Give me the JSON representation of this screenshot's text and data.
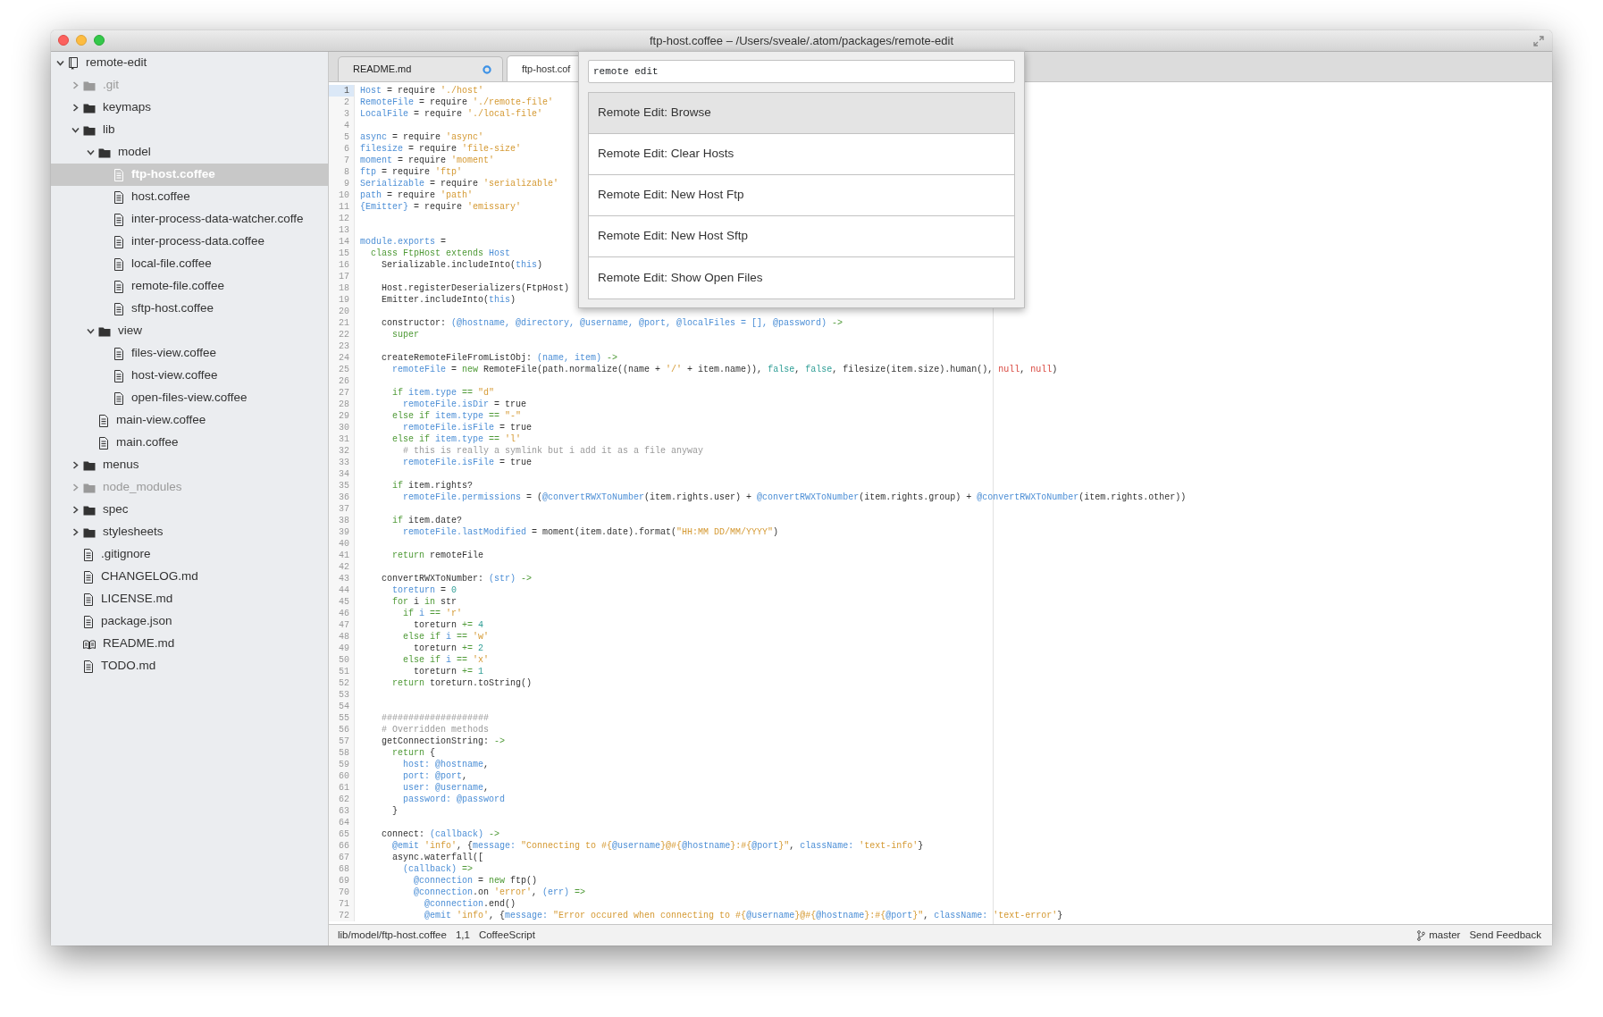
{
  "window": {
    "title": "ftp-host.coffee – /Users/sveale/.atom/packages/remote-edit"
  },
  "tree": [
    {
      "label": "remote-edit",
      "kind": "repo",
      "expanded": true,
      "selected": false,
      "ignored": false,
      "children": [
        {
          "label": ".git",
          "kind": "folder",
          "expanded": false,
          "selected": false,
          "ignored": true
        },
        {
          "label": "keymaps",
          "kind": "folder",
          "expanded": false,
          "selected": false,
          "ignored": false
        },
        {
          "label": "lib",
          "kind": "folder",
          "expanded": true,
          "selected": false,
          "ignored": false,
          "children": [
            {
              "label": "model",
              "kind": "folder",
              "expanded": true,
              "selected": false,
              "ignored": false,
              "children": [
                {
                  "label": "ftp-host.coffee",
                  "kind": "file",
                  "selected": true,
                  "ignored": false
                },
                {
                  "label": "host.coffee",
                  "kind": "file",
                  "selected": false,
                  "ignored": false
                },
                {
                  "label": "inter-process-data-watcher.coffe",
                  "kind": "file",
                  "selected": false,
                  "ignored": false
                },
                {
                  "label": "inter-process-data.coffee",
                  "kind": "file",
                  "selected": false,
                  "ignored": false
                },
                {
                  "label": "local-file.coffee",
                  "kind": "file",
                  "selected": false,
                  "ignored": false
                },
                {
                  "label": "remote-file.coffee",
                  "kind": "file",
                  "selected": false,
                  "ignored": false
                },
                {
                  "label": "sftp-host.coffee",
                  "kind": "file",
                  "selected": false,
                  "ignored": false
                }
              ]
            },
            {
              "label": "view",
              "kind": "folder",
              "expanded": true,
              "selected": false,
              "ignored": false,
              "children": [
                {
                  "label": "files-view.coffee",
                  "kind": "file",
                  "selected": false,
                  "ignored": false
                },
                {
                  "label": "host-view.coffee",
                  "kind": "file",
                  "selected": false,
                  "ignored": false
                },
                {
                  "label": "open-files-view.coffee",
                  "kind": "file",
                  "selected": false,
                  "ignored": false
                }
              ]
            },
            {
              "label": "main-view.coffee",
              "kind": "file",
              "selected": false,
              "ignored": false
            },
            {
              "label": "main.coffee",
              "kind": "file",
              "selected": false,
              "ignored": false
            }
          ]
        },
        {
          "label": "menus",
          "kind": "folder",
          "expanded": false,
          "selected": false,
          "ignored": false
        },
        {
          "label": "node_modules",
          "kind": "folder",
          "expanded": false,
          "selected": false,
          "ignored": true
        },
        {
          "label": "spec",
          "kind": "folder",
          "expanded": false,
          "selected": false,
          "ignored": false
        },
        {
          "label": "stylesheets",
          "kind": "folder",
          "expanded": false,
          "selected": false,
          "ignored": false
        },
        {
          "label": ".gitignore",
          "kind": "file",
          "selected": false,
          "ignored": false
        },
        {
          "label": "CHANGELOG.md",
          "kind": "file",
          "selected": false,
          "ignored": false
        },
        {
          "label": "LICENSE.md",
          "kind": "file",
          "selected": false,
          "ignored": false
        },
        {
          "label": "package.json",
          "kind": "file",
          "selected": false,
          "ignored": false
        },
        {
          "label": "README.md",
          "kind": "readme",
          "selected": false,
          "ignored": false
        },
        {
          "label": "TODO.md",
          "kind": "file",
          "selected": false,
          "ignored": false
        }
      ]
    }
  ],
  "tabs": [
    {
      "label": "README.md",
      "selected": false,
      "modified": true
    },
    {
      "label": "ftp-host.cof",
      "selected": true,
      "modified": false
    }
  ],
  "palette": {
    "query": "remote edit",
    "items": [
      {
        "label": "Remote Edit: Browse",
        "selected": true
      },
      {
        "label": "Remote Edit: Clear Hosts",
        "selected": false
      },
      {
        "label": "Remote Edit: New Host Ftp",
        "selected": false
      },
      {
        "label": "Remote Edit: New Host Sftp",
        "selected": false
      },
      {
        "label": "Remote Edit: Show Open Files",
        "selected": false
      }
    ]
  },
  "editor": {
    "lines": [
      {
        "number": "1",
        "current": true,
        "tokens": [
          {
            "kind": "var",
            "text": "Host"
          },
          {
            "kind": "plain",
            "text": " = require "
          },
          {
            "kind": "string",
            "text": "'./host'"
          }
        ]
      },
      {
        "number": "2",
        "current": false,
        "tokens": [
          {
            "kind": "var",
            "text": "RemoteFile"
          },
          {
            "kind": "plain",
            "text": " = require "
          },
          {
            "kind": "string",
            "text": "'./remote-file'"
          }
        ]
      },
      {
        "number": "3",
        "current": false,
        "tokens": [
          {
            "kind": "var",
            "text": "LocalFile"
          },
          {
            "kind": "plain",
            "text": " = require "
          },
          {
            "kind": "string",
            "text": "'./local-file'"
          }
        ]
      },
      {
        "number": "4",
        "current": false
      },
      {
        "number": "5",
        "current": false,
        "tokens": [
          {
            "kind": "var",
            "text": "async"
          },
          {
            "kind": "plain",
            "text": " = require "
          },
          {
            "kind": "string",
            "text": "'async'"
          }
        ]
      },
      {
        "number": "6",
        "current": false,
        "tokens": [
          {
            "kind": "var",
            "text": "filesize"
          },
          {
            "kind": "plain",
            "text": " = require "
          },
          {
            "kind": "string",
            "text": "'file-size'"
          }
        ]
      },
      {
        "number": "7",
        "current": false,
        "tokens": [
          {
            "kind": "var",
            "text": "moment"
          },
          {
            "kind": "plain",
            "text": " = require "
          },
          {
            "kind": "string",
            "text": "'moment'"
          }
        ]
      },
      {
        "number": "8",
        "current": false,
        "tokens": [
          {
            "kind": "var",
            "text": "ftp"
          },
          {
            "kind": "plain",
            "text": " = require "
          },
          {
            "kind": "string",
            "text": "'ftp'"
          }
        ]
      },
      {
        "number": "9",
        "current": false,
        "tokens": [
          {
            "kind": "var",
            "text": "Serializable"
          },
          {
            "kind": "plain",
            "text": " = require "
          },
          {
            "kind": "string",
            "text": "'serializable'"
          }
        ]
      },
      {
        "number": "10",
        "current": false,
        "tokens": [
          {
            "kind": "var",
            "text": "path"
          },
          {
            "kind": "plain",
            "text": " = require "
          },
          {
            "kind": "string",
            "text": "'path'"
          }
        ]
      },
      {
        "number": "11",
        "current": false,
        "tokens": [
          {
            "kind": "var",
            "text": "{Emitter}"
          },
          {
            "kind": "plain",
            "text": " = require "
          },
          {
            "kind": "string",
            "text": "'emissary'"
          }
        ]
      },
      {
        "number": "12",
        "current": false
      },
      {
        "number": "13",
        "current": false
      },
      {
        "number": "14",
        "current": false,
        "tokens": [
          {
            "kind": "var",
            "text": "module.exports"
          },
          {
            "kind": "plain",
            "text": " ="
          }
        ]
      },
      {
        "number": "15",
        "current": false,
        "tokens": [
          {
            "kind": "keyword",
            "text": "  class FtpHost extends"
          },
          {
            "kind": "var",
            "text": " Host"
          }
        ]
      },
      {
        "number": "16",
        "current": false,
        "tokens": [
          {
            "kind": "plain",
            "text": "    Serializable.includeInto("
          },
          {
            "kind": "var",
            "text": "this"
          },
          {
            "kind": "plain",
            "text": ")"
          }
        ]
      },
      {
        "number": "17",
        "current": false
      },
      {
        "number": "18",
        "current": false,
        "tokens": [
          {
            "kind": "plain",
            "text": "    Host.registerDeserializers(FtpHost)"
          }
        ]
      },
      {
        "number": "19",
        "current": false,
        "tokens": [
          {
            "kind": "plain",
            "text": "    Emitter.includeInto("
          },
          {
            "kind": "var",
            "text": "this"
          },
          {
            "kind": "plain",
            "text": ")"
          }
        ]
      },
      {
        "number": "20",
        "current": false
      },
      {
        "number": "21",
        "current": false,
        "tokens": [
          {
            "kind": "plain",
            "text": "    constructor: "
          },
          {
            "kind": "var",
            "text": "(@hostname, @directory, @username, @port, @localFiles = [], @password)"
          },
          {
            "kind": "keyword",
            "text": " ->"
          }
        ]
      },
      {
        "number": "22",
        "current": false,
        "tokens": [
          {
            "kind": "keyword",
            "text": "      super"
          }
        ]
      },
      {
        "number": "23",
        "current": false
      },
      {
        "number": "24",
        "current": false,
        "tokens": [
          {
            "kind": "plain",
            "text": "    createRemoteFileFromListObj: "
          },
          {
            "kind": "var",
            "text": "(name, item)"
          },
          {
            "kind": "keyword",
            "text": " ->"
          }
        ]
      },
      {
        "number": "25",
        "current": false,
        "tokens": [
          {
            "kind": "var",
            "text": "      remoteFile"
          },
          {
            "kind": "plain",
            "text": " = "
          },
          {
            "kind": "keyword",
            "text": "new"
          },
          {
            "kind": "plain",
            "text": " RemoteFile(path.normalize((name + "
          },
          {
            "kind": "string",
            "text": "'/'"
          },
          {
            "kind": "plain",
            "text": " + item.name)), "
          },
          {
            "kind": "number",
            "text": "false"
          },
          {
            "kind": "plain",
            "text": ", "
          },
          {
            "kind": "number",
            "text": "false"
          },
          {
            "kind": "plain",
            "text": ", filesize(item.size).human(), "
          },
          {
            "kind": "null",
            "text": "null"
          },
          {
            "kind": "plain",
            "text": ", "
          },
          {
            "kind": "null",
            "text": "null"
          },
          {
            "kind": "plain",
            "text": ")"
          }
        ]
      },
      {
        "number": "26",
        "current": false
      },
      {
        "number": "27",
        "current": false,
        "tokens": [
          {
            "kind": "keyword",
            "text": "      if "
          },
          {
            "kind": "var",
            "text": "item.type"
          },
          {
            "kind": "keyword",
            "text": " == "
          },
          {
            "kind": "string",
            "text": "\"d\""
          }
        ]
      },
      {
        "number": "28",
        "current": false,
        "tokens": [
          {
            "kind": "var",
            "text": "        remoteFile.isDir"
          },
          {
            "kind": "plain",
            "text": " = true"
          }
        ]
      },
      {
        "number": "29",
        "current": false,
        "tokens": [
          {
            "kind": "keyword",
            "text": "      else if "
          },
          {
            "kind": "var",
            "text": "item.type"
          },
          {
            "kind": "keyword",
            "text": " == "
          },
          {
            "kind": "string",
            "text": "\"-\""
          }
        ]
      },
      {
        "number": "30",
        "current": false,
        "tokens": [
          {
            "kind": "var",
            "text": "        remoteFile.isFile"
          },
          {
            "kind": "plain",
            "text": " = true"
          }
        ]
      },
      {
        "number": "31",
        "current": false,
        "tokens": [
          {
            "kind": "keyword",
            "text": "      else if "
          },
          {
            "kind": "var",
            "text": "item.type"
          },
          {
            "kind": "keyword",
            "text": " == "
          },
          {
            "kind": "string",
            "text": "'l'"
          }
        ]
      },
      {
        "number": "32",
        "current": false,
        "tokens": [
          {
            "kind": "comment",
            "text": "        # this is really a symlink but i add it as a file anyway"
          }
        ]
      },
      {
        "number": "33",
        "current": false,
        "tokens": [
          {
            "kind": "var",
            "text": "        remoteFile.isFile"
          },
          {
            "kind": "plain",
            "text": " = true"
          }
        ]
      },
      {
        "number": "34",
        "current": false
      },
      {
        "number": "35",
        "current": false,
        "tokens": [
          {
            "kind": "keyword",
            "text": "      if "
          },
          {
            "kind": "plain",
            "text": "item.rights?"
          }
        ]
      },
      {
        "number": "36",
        "current": false,
        "tokens": [
          {
            "kind": "var",
            "text": "        remoteFile.permissions"
          },
          {
            "kind": "plain",
            "text": " = ("
          },
          {
            "kind": "var",
            "text": "@convertRWXToNumber"
          },
          {
            "kind": "plain",
            "text": "(item.rights.user) + "
          },
          {
            "kind": "var",
            "text": "@convertRWXToNumber"
          },
          {
            "kind": "plain",
            "text": "(item.rights.group) + "
          },
          {
            "kind": "var",
            "text": "@convertRWXToNumber"
          },
          {
            "kind": "plain",
            "text": "(item.rights.other))"
          }
        ]
      },
      {
        "number": "37",
        "current": false
      },
      {
        "number": "38",
        "current": false,
        "tokens": [
          {
            "kind": "keyword",
            "text": "      if "
          },
          {
            "kind": "plain",
            "text": "item.date?"
          }
        ]
      },
      {
        "number": "39",
        "current": false,
        "tokens": [
          {
            "kind": "var",
            "text": "        remoteFile.lastModified"
          },
          {
            "kind": "plain",
            "text": " = moment(item.date).format("
          },
          {
            "kind": "string",
            "text": "\"HH:MM DD/MM/YYYY\""
          },
          {
            "kind": "plain",
            "text": ")"
          }
        ]
      },
      {
        "number": "40",
        "current": false
      },
      {
        "number": "41",
        "current": false,
        "tokens": [
          {
            "kind": "keyword",
            "text": "      return"
          },
          {
            "kind": "plain",
            "text": " remoteFile"
          }
        ]
      },
      {
        "number": "42",
        "current": false
      },
      {
        "number": "43",
        "current": false,
        "tokens": [
          {
            "kind": "plain",
            "text": "    convertRWXToNumber: "
          },
          {
            "kind": "var",
            "text": "(str)"
          },
          {
            "kind": "keyword",
            "text": " ->"
          }
        ]
      },
      {
        "number": "44",
        "current": false,
        "tokens": [
          {
            "kind": "var",
            "text": "      toreturn"
          },
          {
            "kind": "plain",
            "text": " = "
          },
          {
            "kind": "number",
            "text": "0"
          }
        ]
      },
      {
        "number": "45",
        "current": false,
        "tokens": [
          {
            "kind": "keyword",
            "text": "      for "
          },
          {
            "kind": "plain",
            "text": "i"
          },
          {
            "kind": "keyword",
            "text": " in "
          },
          {
            "kind": "plain",
            "text": "str"
          }
        ]
      },
      {
        "number": "46",
        "current": false,
        "tokens": [
          {
            "kind": "keyword",
            "text": "        if "
          },
          {
            "kind": "var",
            "text": "i"
          },
          {
            "kind": "keyword",
            "text": " == "
          },
          {
            "kind": "string",
            "text": "'r'"
          }
        ]
      },
      {
        "number": "47",
        "current": false,
        "tokens": [
          {
            "kind": "plain",
            "text": "          toreturn "
          },
          {
            "kind": "keyword",
            "text": "+= "
          },
          {
            "kind": "number",
            "text": "4"
          }
        ]
      },
      {
        "number": "48",
        "current": false,
        "tokens": [
          {
            "kind": "keyword",
            "text": "        else if "
          },
          {
            "kind": "var",
            "text": "i"
          },
          {
            "kind": "keyword",
            "text": " == "
          },
          {
            "kind": "string",
            "text": "'w'"
          }
        ]
      },
      {
        "number": "49",
        "current": false,
        "tokens": [
          {
            "kind": "plain",
            "text": "          toreturn "
          },
          {
            "kind": "keyword",
            "text": "+= "
          },
          {
            "kind": "number",
            "text": "2"
          }
        ]
      },
      {
        "number": "50",
        "current": false,
        "tokens": [
          {
            "kind": "keyword",
            "text": "        else if "
          },
          {
            "kind": "var",
            "text": "i"
          },
          {
            "kind": "keyword",
            "text": " == "
          },
          {
            "kind": "string",
            "text": "'x'"
          }
        ]
      },
      {
        "number": "51",
        "current": false,
        "tokens": [
          {
            "kind": "plain",
            "text": "          toreturn "
          },
          {
            "kind": "keyword",
            "text": "+= "
          },
          {
            "kind": "number",
            "text": "1"
          }
        ]
      },
      {
        "number": "52",
        "current": false,
        "tokens": [
          {
            "kind": "keyword",
            "text": "      return"
          },
          {
            "kind": "plain",
            "text": " toreturn.toString()"
          }
        ]
      },
      {
        "number": "53",
        "current": false
      },
      {
        "number": "54",
        "current": false
      },
      {
        "number": "55",
        "current": false,
        "tokens": [
          {
            "kind": "comment",
            "text": "    ####################"
          }
        ]
      },
      {
        "number": "56",
        "current": false,
        "tokens": [
          {
            "kind": "comment",
            "text": "    # Overridden methods"
          }
        ]
      },
      {
        "number": "57",
        "current": false,
        "tokens": [
          {
            "kind": "plain",
            "text": "    getConnectionString: "
          },
          {
            "kind": "keyword",
            "text": "->"
          }
        ]
      },
      {
        "number": "58",
        "current": false,
        "tokens": [
          {
            "kind": "keyword",
            "text": "      return"
          },
          {
            "kind": "plain",
            "text": " {"
          }
        ]
      },
      {
        "number": "59",
        "current": false,
        "tokens": [
          {
            "kind": "var",
            "text": "        host: @hostname"
          },
          {
            "kind": "plain",
            "text": ","
          }
        ]
      },
      {
        "number": "60",
        "current": false,
        "tokens": [
          {
            "kind": "var",
            "text": "        port: @port"
          },
          {
            "kind": "plain",
            "text": ","
          }
        ]
      },
      {
        "number": "61",
        "current": false,
        "tokens": [
          {
            "kind": "var",
            "text": "        user: @username"
          },
          {
            "kind": "plain",
            "text": ","
          }
        ]
      },
      {
        "number": "62",
        "current": false,
        "tokens": [
          {
            "kind": "var",
            "text": "        password: @password"
          }
        ]
      },
      {
        "number": "63",
        "current": false,
        "tokens": [
          {
            "kind": "plain",
            "text": "      }"
          }
        ]
      },
      {
        "number": "64",
        "current": false
      },
      {
        "number": "65",
        "current": false,
        "tokens": [
          {
            "kind": "plain",
            "text": "    connect: "
          },
          {
            "kind": "var",
            "text": "(callback)"
          },
          {
            "kind": "keyword",
            "text": " ->"
          }
        ]
      },
      {
        "number": "66",
        "current": false,
        "tokens": [
          {
            "kind": "var",
            "text": "      @emit"
          },
          {
            "kind": "string",
            "text": " 'info'"
          },
          {
            "kind": "plain",
            "text": ", {"
          },
          {
            "kind": "var",
            "text": "message: "
          },
          {
            "kind": "string",
            "text": "\"Connecting to #{"
          },
          {
            "kind": "var",
            "text": "@username"
          },
          {
            "kind": "string",
            "text": "}@#{"
          },
          {
            "kind": "var",
            "text": "@hostname"
          },
          {
            "kind": "string",
            "text": "}:#{"
          },
          {
            "kind": "var",
            "text": "@port"
          },
          {
            "kind": "string",
            "text": "}\""
          },
          {
            "kind": "plain",
            "text": ", "
          },
          {
            "kind": "var",
            "text": "className: "
          },
          {
            "kind": "string",
            "text": "'text-info'"
          },
          {
            "kind": "plain",
            "text": "}"
          }
        ]
      },
      {
        "number": "67",
        "current": false,
        "tokens": [
          {
            "kind": "plain",
            "text": "      async.waterfall(["
          }
        ]
      },
      {
        "number": "68",
        "current": false,
        "tokens": [
          {
            "kind": "var",
            "text": "        (callback)"
          },
          {
            "kind": "keyword",
            "text": " =>"
          }
        ]
      },
      {
        "number": "69",
        "current": false,
        "tokens": [
          {
            "kind": "var",
            "text": "          @connection"
          },
          {
            "kind": "plain",
            "text": " = "
          },
          {
            "kind": "keyword",
            "text": "new"
          },
          {
            "kind": "plain",
            "text": " ftp()"
          }
        ]
      },
      {
        "number": "70",
        "current": false,
        "tokens": [
          {
            "kind": "var",
            "text": "          @connection"
          },
          {
            "kind": "plain",
            "text": ".on "
          },
          {
            "kind": "string",
            "text": "'error'"
          },
          {
            "kind": "plain",
            "text": ", "
          },
          {
            "kind": "var",
            "text": "(err)"
          },
          {
            "kind": "keyword",
            "text": " =>"
          }
        ]
      },
      {
        "number": "71",
        "current": false,
        "tokens": [
          {
            "kind": "var",
            "text": "            @connection"
          },
          {
            "kind": "plain",
            "text": ".end()"
          }
        ]
      },
      {
        "number": "72",
        "current": false,
        "tokens": [
          {
            "kind": "var",
            "text": "            @emit"
          },
          {
            "kind": "string",
            "text": " 'info'"
          },
          {
            "kind": "plain",
            "text": ", {"
          },
          {
            "kind": "var",
            "text": "message: "
          },
          {
            "kind": "string",
            "text": "\"Error occured when connecting to #{"
          },
          {
            "kind": "var",
            "text": "@username"
          },
          {
            "kind": "string",
            "text": "}@#{"
          },
          {
            "kind": "var",
            "text": "@hostname"
          },
          {
            "kind": "string",
            "text": "}:#{"
          },
          {
            "kind": "var",
            "text": "@port"
          },
          {
            "kind": "string",
            "text": "}\""
          },
          {
            "kind": "plain",
            "text": ", "
          },
          {
            "kind": "var",
            "text": "className: "
          },
          {
            "kind": "string",
            "text": "'text-error'"
          },
          {
            "kind": "plain",
            "text": "}"
          }
        ]
      }
    ]
  },
  "status_bar": {
    "path": "lib/model/ftp-host.coffee",
    "cursor": "1,1",
    "grammar": "CoffeeScript",
    "branch": "master",
    "feedback": "Send Feedback"
  }
}
